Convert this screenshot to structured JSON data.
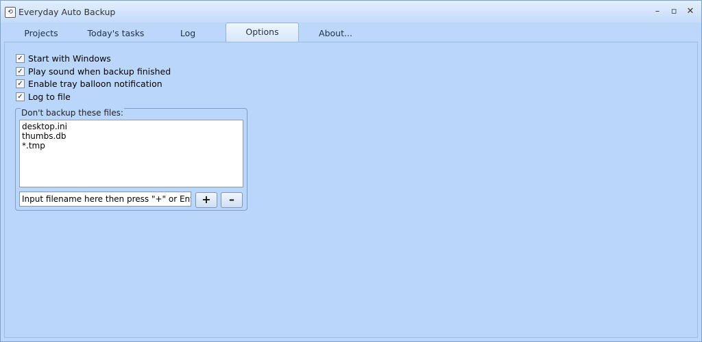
{
  "window": {
    "title": "Everyday Auto Backup",
    "minimize": "–",
    "maximize": "▫",
    "close": "✕",
    "icon_glyph": "⟲"
  },
  "tabs": [
    {
      "label": "Projects"
    },
    {
      "label": "Today's tasks"
    },
    {
      "label": "Log"
    },
    {
      "label": "Options",
      "active": true
    },
    {
      "label": "About..."
    }
  ],
  "options": {
    "checkboxes": [
      {
        "label": "Start with Windows",
        "checked": true
      },
      {
        "label": "Play sound when backup finished",
        "checked": true
      },
      {
        "label": "Enable tray balloon notification",
        "checked": true
      },
      {
        "label": "Log to file",
        "checked": true
      }
    ],
    "exclude_group": {
      "legend": "Don't backup these files:",
      "files": [
        "desktop.ini",
        "thumbs.db",
        "*.tmp"
      ],
      "input_value": "Input filename here then press \"+\" or Enter",
      "add_label": "+",
      "remove_label": "–"
    }
  },
  "colors": {
    "panel": "#bad6fb",
    "accent": "#7d9fce"
  }
}
